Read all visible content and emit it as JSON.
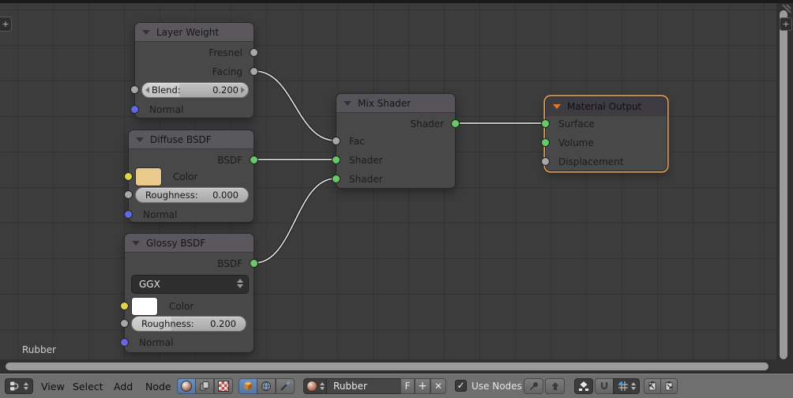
{
  "canvas": {
    "tree_label": "Rubber",
    "plus_left": "+",
    "plus_right": "+"
  },
  "nodes": {
    "layer_weight": {
      "title": "Layer Weight",
      "output_fresnel": "Fresnel",
      "output_facing": "Facing",
      "blend_label": "Blend:",
      "blend_value": "0.200",
      "input_normal": "Normal"
    },
    "diffuse_bsdf": {
      "title": "Diffuse BSDF",
      "output_bsdf": "BSDF",
      "color_label": "Color",
      "roughness_label": "Roughness:",
      "roughness_value": "0.000",
      "input_normal": "Normal"
    },
    "glossy_bsdf": {
      "title": "Glossy BSDF",
      "output_bsdf": "BSDF",
      "distribution": "GGX",
      "color_label": "Color",
      "roughness_label": "Roughness:",
      "roughness_value": "0.200",
      "input_normal": "Normal"
    },
    "mix_shader": {
      "title": "Mix Shader",
      "output_shader": "Shader",
      "input_fac": "Fac",
      "input_shader1": "Shader",
      "input_shader2": "Shader"
    },
    "material_output": {
      "title": "Material Output",
      "input_surface": "Surface",
      "input_volume": "Volume",
      "input_displacement": "Displacement"
    }
  },
  "links": [
    {
      "from": "Layer Weight / Facing",
      "to": "Mix Shader / Fac"
    },
    {
      "from": "Diffuse BSDF / BSDF",
      "to": "Mix Shader / Shader"
    },
    {
      "from": "Glossy BSDF / BSDF",
      "to": "Mix Shader / Shader (2)"
    },
    {
      "from": "Mix Shader / Shader",
      "to": "Material Output / Surface"
    }
  ],
  "toolbar": {
    "menus": [
      "View",
      "Select",
      "Add",
      "Node"
    ],
    "material_name": "Rubber",
    "fake_user_label": "F",
    "new_label": "+",
    "unlink_label": "✕",
    "use_nodes_check": "✓",
    "use_nodes_label": "Use Nodes",
    "icons": [
      "editor-type",
      "shader-tree",
      "compositing-tree",
      "texture-tree",
      "object-shader",
      "world-shader",
      "linestyle-shader",
      "material-preview",
      "pin",
      "parent-tree",
      "auto-offset",
      "snap-magnet",
      "snap-element",
      "copy-nodes",
      "paste-nodes"
    ]
  },
  "colors": {
    "selected_node_outline": "#ED9D49",
    "header_triangle_selected": "#E5772D",
    "socket_shader_green": "#67C967",
    "socket_value_gray": "#A7A7A7",
    "socket_color_yellow": "#E0D44B",
    "socket_vector_blue": "#6268E2",
    "diffuse_color_swatch": "#E9C98C",
    "glossy_color_swatch": "#FFFFFF",
    "active_toolbar_button": "#5E81B5"
  }
}
